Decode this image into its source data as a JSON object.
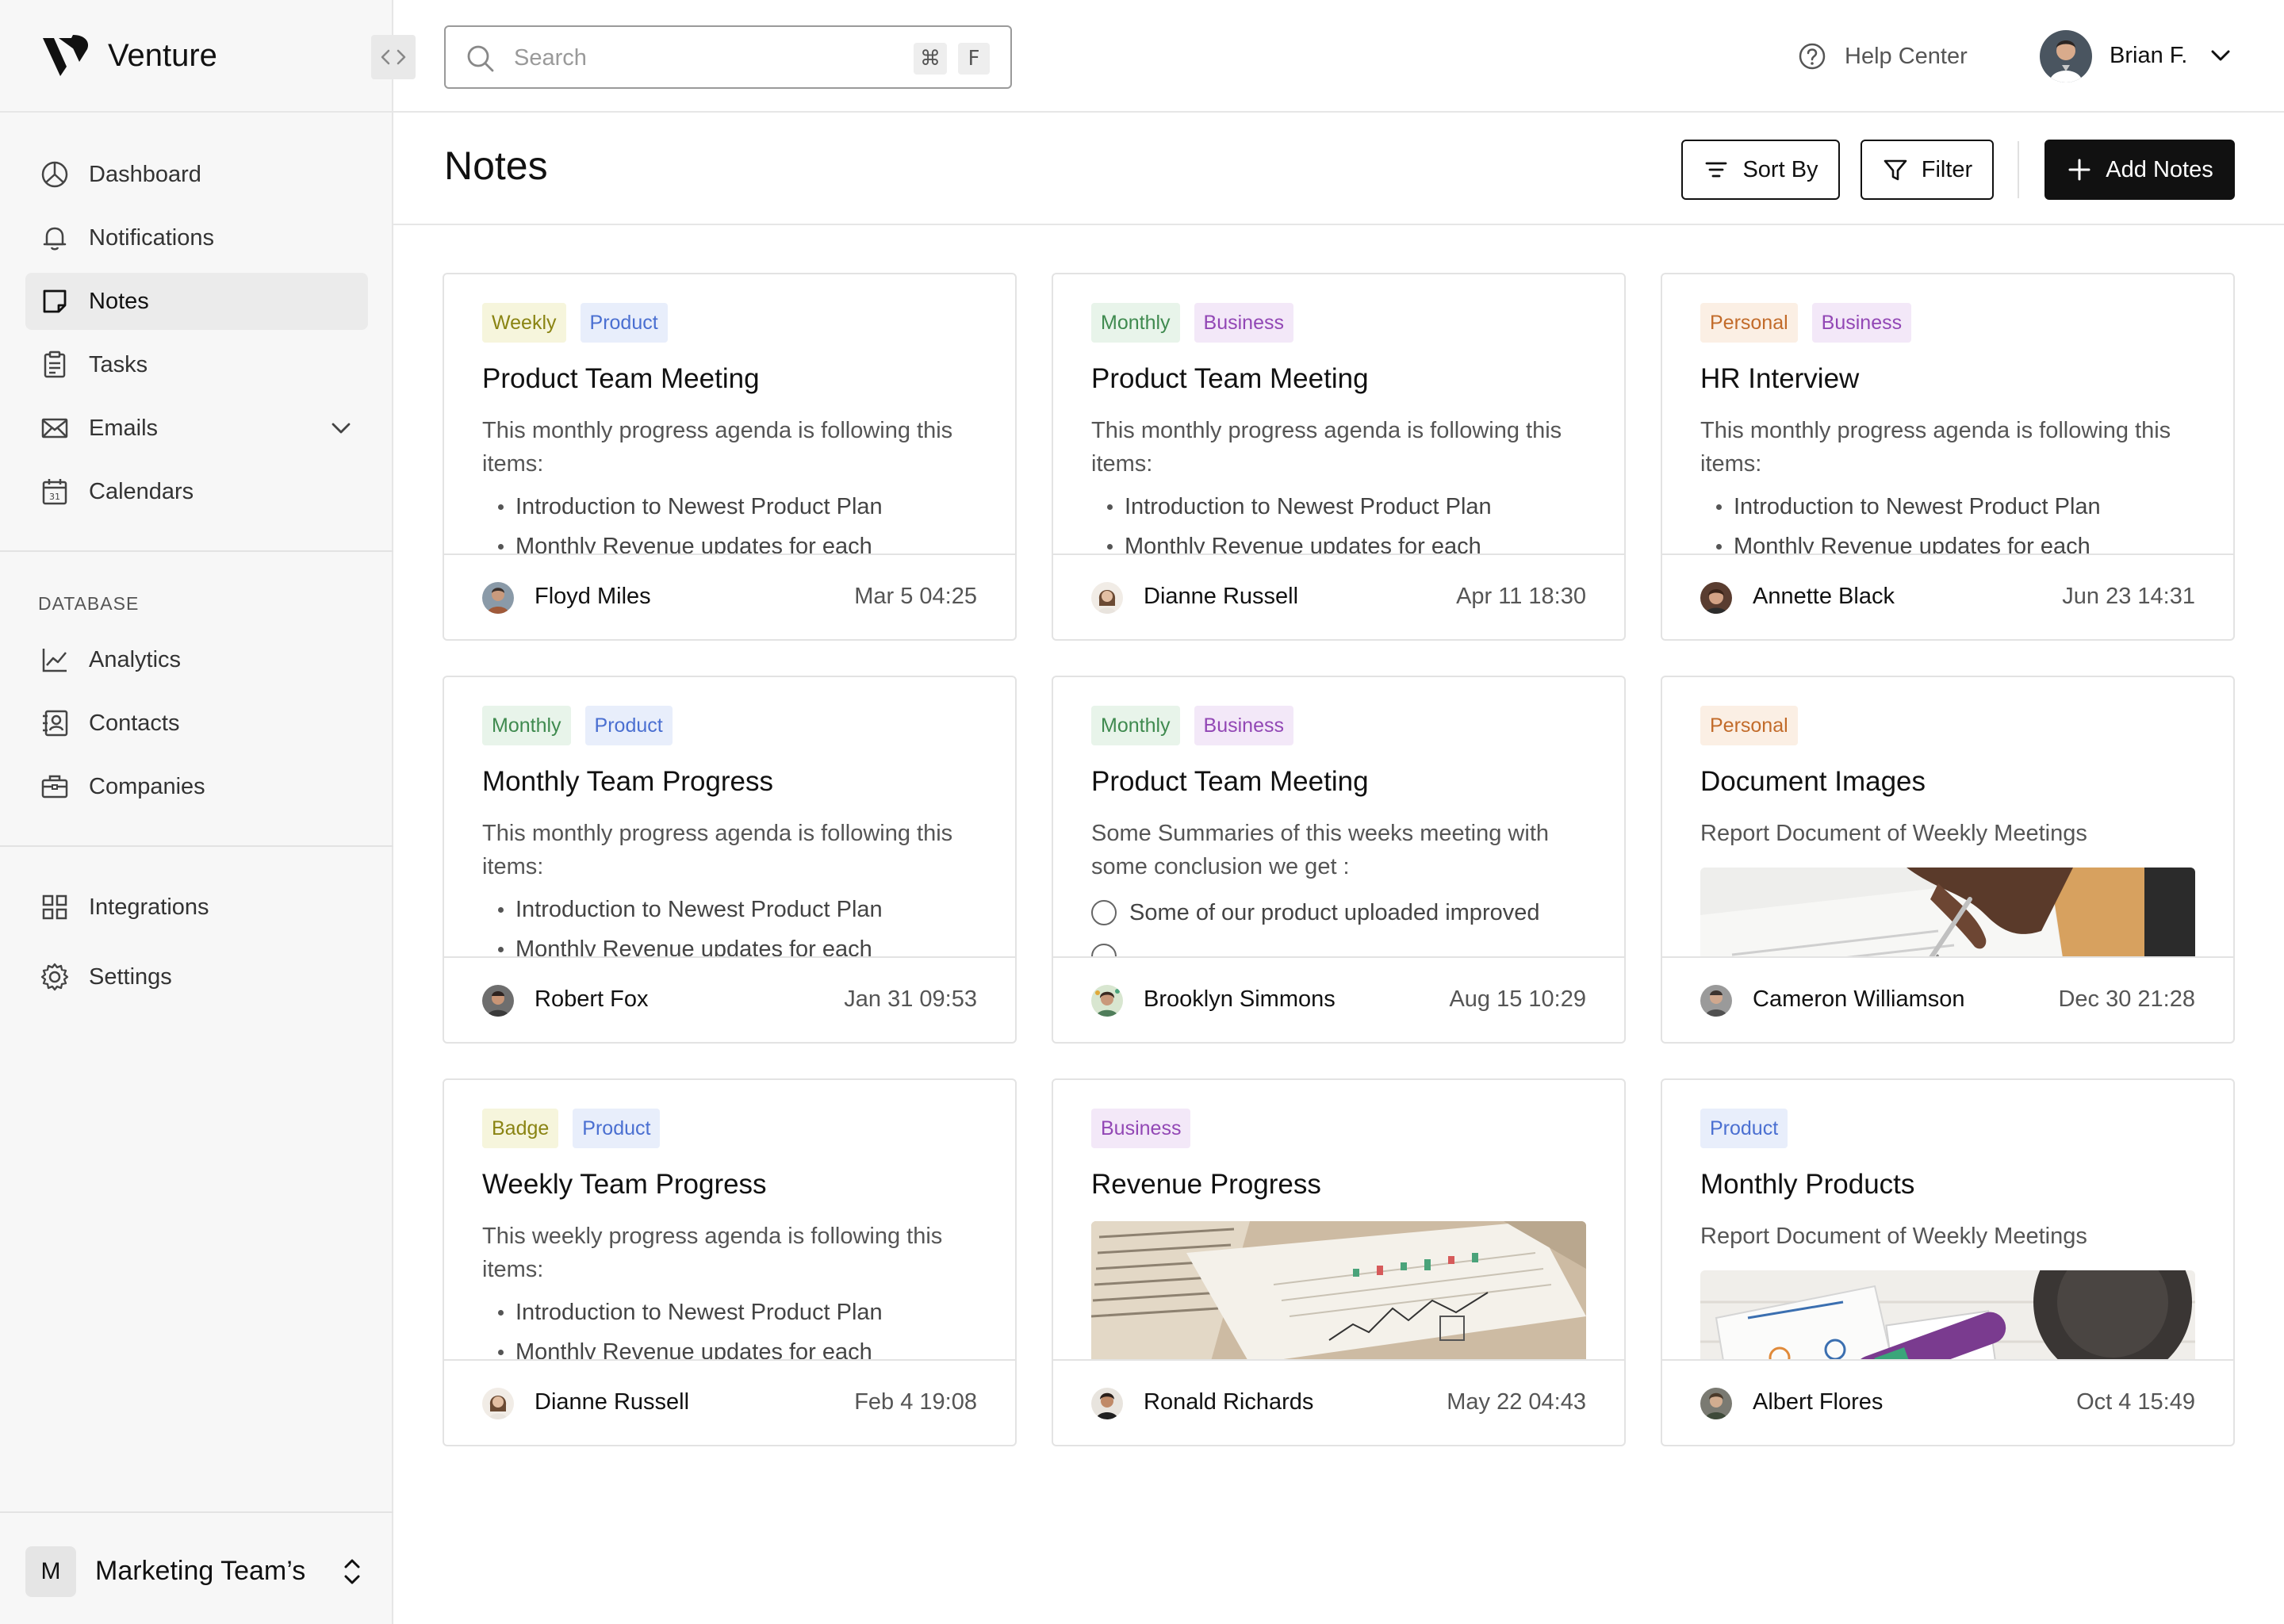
{
  "app": {
    "name": "Venture"
  },
  "sidebar": {
    "nav": [
      {
        "label": "Dashboard",
        "icon": "dashboard-icon"
      },
      {
        "label": "Notifications",
        "icon": "bell-icon"
      },
      {
        "label": "Notes",
        "icon": "note-icon",
        "active": true
      },
      {
        "label": "Tasks",
        "icon": "clipboard-icon"
      },
      {
        "label": "Emails",
        "icon": "mail-icon",
        "expandable": true
      },
      {
        "label": "Calendars",
        "icon": "calendar-icon"
      }
    ],
    "database_label": "DATABASE",
    "database": [
      {
        "label": "Analytics",
        "icon": "chart-line-icon"
      },
      {
        "label": "Contacts",
        "icon": "contacts-icon"
      },
      {
        "label": "Companies",
        "icon": "briefcase-icon"
      }
    ],
    "bottom": [
      {
        "label": "Integrations",
        "icon": "grid-icon"
      },
      {
        "label": "Settings",
        "icon": "gear-icon"
      }
    ],
    "workspace": {
      "initial": "M",
      "name": "Marketing Team’s"
    }
  },
  "topbar": {
    "search_placeholder": "Search",
    "shortcut": [
      "⌘",
      "F"
    ],
    "help_label": "Help Center",
    "user_name": "Brian F."
  },
  "page": {
    "title": "Notes",
    "sort_label": "Sort By",
    "filter_label": "Filter",
    "add_label": "Add Notes"
  },
  "tag_colors": {
    "Weekly": {
      "bg": "#f6f5dc",
      "fg": "#8a8413"
    },
    "Monthly": {
      "bg": "#e8f4ea",
      "fg": "#3f8a4f"
    },
    "Personal": {
      "bg": "#fbefe4",
      "fg": "#c26b2a"
    },
    "Product": {
      "bg": "#e8eefb",
      "fg": "#4a6fd1"
    },
    "Business": {
      "bg": "#f3e8f8",
      "fg": "#9247b5"
    },
    "Badge": {
      "bg": "#f6f5dc",
      "fg": "#8a8413"
    }
  },
  "notes": [
    {
      "tags": [
        "Weekly",
        "Product"
      ],
      "title": "Product Team Meeting",
      "description": "This monthly progress agenda is following this items:",
      "bullets": [
        "Introduction to Newest Product Plan",
        "Monthly Revenue updates for each"
      ],
      "author": "Floyd Miles",
      "date": "Mar 5 04:25"
    },
    {
      "tags": [
        "Monthly",
        "Business"
      ],
      "title": "Product Team Meeting",
      "description": "This monthly progress agenda is following this items:",
      "bullets": [
        "Introduction to Newest Product Plan",
        "Monthly Revenue updates for each"
      ],
      "author": "Dianne Russell",
      "date": "Apr 11 18:30"
    },
    {
      "tags": [
        "Personal",
        "Business"
      ],
      "title": "HR Interview",
      "description": "This monthly progress agenda is following this items:",
      "bullets": [
        "Introduction to Newest Product Plan",
        "Monthly Revenue updates for each"
      ],
      "author": "Annette Black",
      "date": "Jun 23 14:31"
    },
    {
      "tags": [
        "Monthly",
        "Product"
      ],
      "title": "Monthly Team Progress",
      "description": "This monthly progress agenda is following this items:",
      "bullets": [
        "Introduction to Newest Product Plan",
        "Monthly Revenue updates for each"
      ],
      "author": "Robert Fox",
      "date": "Jan 31 09:53"
    },
    {
      "tags": [
        "Monthly",
        "Business"
      ],
      "title": "Product Team Meeting",
      "description": "Some Summaries of this weeks meeting with some conclusion we get :",
      "checklist": [
        "Some of our product uploaded improved"
      ],
      "author": "Brooklyn Simmons",
      "date": "Aug 15 10:29"
    },
    {
      "tags": [
        "Personal"
      ],
      "title": "Document Images",
      "description": "Report Document of Weekly Meetings",
      "image": "hand-writing-photo",
      "author": "Cameron Williamson",
      "date": "Dec 30 21:28"
    },
    {
      "tags": [
        "Badge",
        "Product"
      ],
      "title": "Weekly Team Progress",
      "description": "This weekly progress agenda is following this items:",
      "bullets": [
        "Introduction to Newest Product Plan",
        "Monthly Revenue updates for each"
      ],
      "author": "Dianne Russell",
      "date": "Feb 4 19:08"
    },
    {
      "tags": [
        "Business"
      ],
      "title": "Revenue Progress",
      "image": "financial-chart-photo",
      "author": "Ronald Richards",
      "date": "May 22 04:43"
    },
    {
      "tags": [
        "Product"
      ],
      "title": "Monthly Products",
      "description": "Report Document of Weekly Meetings",
      "image": "desk-items-photo",
      "author": "Albert Flores",
      "date": "Oct 4 15:49"
    }
  ]
}
